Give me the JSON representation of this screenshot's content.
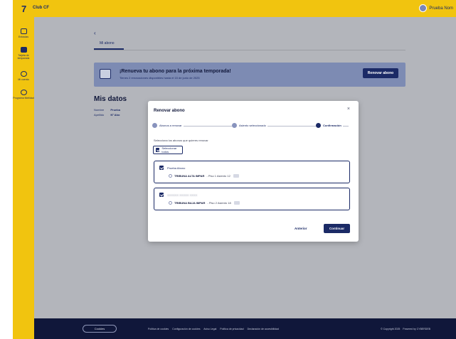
{
  "header": {
    "logo": "7",
    "brand": "Club CF",
    "user_name": "Prueba Nom"
  },
  "sidebar": {
    "items": [
      {
        "label": "Entradas",
        "icon": "ticket-icon"
      },
      {
        "label": "Tarjeta de temporada",
        "icon": "card-icon"
      },
      {
        "label": "Mi cuenta",
        "icon": "user-icon"
      },
      {
        "label": "Programa fidelidad",
        "icon": "star-icon"
      }
    ],
    "active_index": 1
  },
  "page": {
    "back": "‹",
    "tab": "Mi abono"
  },
  "banner": {
    "title": "¡Renueva tu abono para la próxima temporada!",
    "subtitle": "Tienes 2 renovaciones disponibles hasta el 15 de junio de 2025",
    "button": "Renovar abono"
  },
  "datos": {
    "title": "Mis datos",
    "rows": [
      {
        "label": "Nombre",
        "value": "Prueba"
      },
      {
        "label": "Apellido",
        "value": "Nº Abo"
      }
    ]
  },
  "modal": {
    "title": "Renovar abono",
    "close": "×",
    "steps": [
      "Abonos a renovar",
      "Asiento seleccionado",
      "Confirmación"
    ],
    "current_step": 2,
    "select_label": "Selecciona los abonos que quieres renovar",
    "select_all": "Seleccionar todos",
    "cards": [
      {
        "name": "Prueba Abono",
        "seat_zone": "TRIBUNA ALTA IMPAR",
        "seat_detail": "- Piso 1 Asiento 12"
      },
      {
        "name": "XXXXXX XXXXX XXXX",
        "seat_zone": "TRIBUNA BAJA IMPAR",
        "seat_detail": "- Piso 2 Asiento 18"
      }
    ],
    "back_button": "Anterior",
    "next_button": "Continuar"
  },
  "footer": {
    "cookies": "Cookies",
    "links": [
      "Política de cookies",
      "Configuración de cookies",
      "Aviso Legal",
      "Política de privacidad",
      "Declaración de accesibilidad"
    ],
    "copyright": "© Copyright 2025",
    "powered": "Powered by CYBERDEB"
  },
  "colors": {
    "brand_yellow": "#f1c40f",
    "navy": "#1b2a66",
    "footer": "#10173a"
  }
}
